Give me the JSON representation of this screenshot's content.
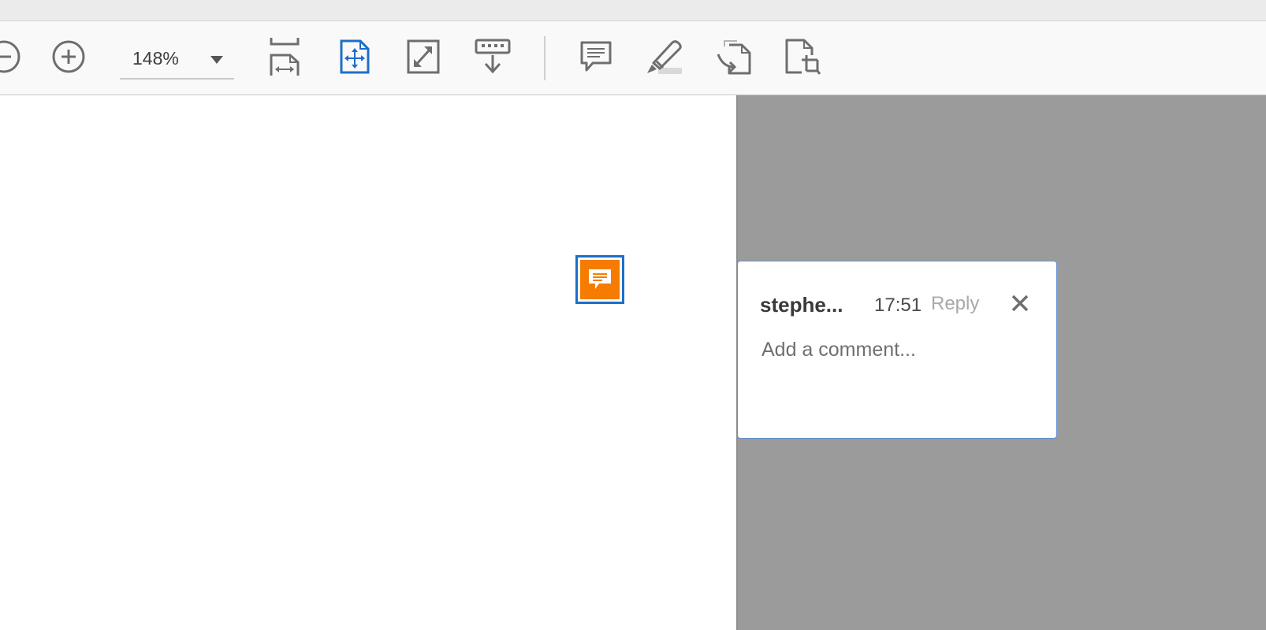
{
  "toolbar": {
    "zoom_value": "148%",
    "icons": {
      "zoom_out": "zoom-out-icon",
      "zoom_in": "zoom-in-icon",
      "zoom_dropdown": "chevron-down-icon",
      "fit_width": "fit-width-icon",
      "fit_page": "fit-page-icon",
      "full_screen": "full-screen-icon",
      "scrolling_mode": "scroll-mode-icon",
      "comment": "comment-icon",
      "highlight": "highlighter-icon",
      "export_pdf": "export-pdf-icon",
      "crop": "crop-page-icon"
    }
  },
  "document": {
    "sticky_note_icon": "sticky-note-icon"
  },
  "comment_popup": {
    "author": "stephe...",
    "time": "17:51",
    "reply_label": "Reply",
    "input_placeholder": "Add a comment...",
    "input_value": "",
    "close_icon": "close-icon"
  },
  "colors": {
    "accent_blue": "#1e6ec8",
    "note_orange": "#f57c00",
    "pane_gray": "#9b9b9b",
    "icon_gray": "#6e6e6e",
    "card_border": "#5b8fd6"
  }
}
